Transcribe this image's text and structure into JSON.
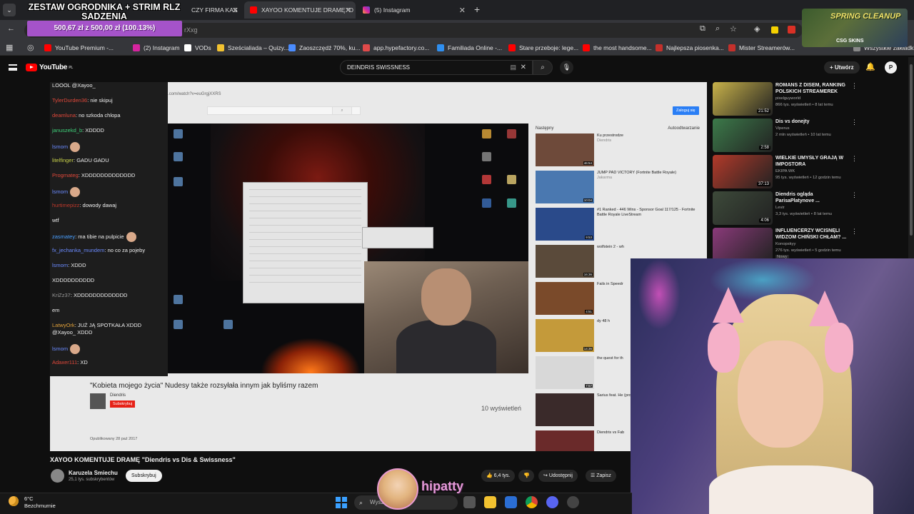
{
  "overlay": {
    "goal_title": "ZESTAW OGRODNIKA + STRIM RLZ SADZENIA",
    "goal_progress": "500,67 zł z 500,00 zł (100.13%)",
    "goal_percent": 100.13,
    "streamer_name": "hipatty",
    "promo_title": "SPRING CLEANUP",
    "promo_brand": "CSG SKINS"
  },
  "tabs": [
    {
      "label": "CZY FIRMA KAS",
      "active": false
    },
    {
      "label": "XAYOO KOMENTUJE DRAMĘ \"D",
      "active": true
    },
    {
      "label": "(5) Instagram",
      "active": false
    }
  ],
  "omnibox": {
    "url_fragment": "rXxg"
  },
  "bookmarks": [
    {
      "label": "YouTube Premium -...",
      "color": "#ff0000"
    },
    {
      "label": "(2) Instagram",
      "color": "#d6249f"
    },
    {
      "label": "VODs",
      "color": "#ffffff"
    },
    {
      "label": "Sześcialiada – Quizy...",
      "color": "#f2c230"
    },
    {
      "label": "Zaoszczędź 70%, ku...",
      "color": "#4a8cff"
    },
    {
      "label": "app.hypefactory.co...",
      "color": "#e04a4a"
    },
    {
      "label": "Familiada Online -...",
      "color": "#2f8ff0"
    },
    {
      "label": "Stare przeboje: lege...",
      "color": "#ff0000"
    },
    {
      "label": "the most handsome...",
      "color": "#ff0000"
    },
    {
      "label": "Najlepsza piosenka...",
      "color": "#c4302b"
    },
    {
      "label": "Mister Streamerów...",
      "color": "#c4302b"
    },
    {
      "label": "Wszystkie zakładki",
      "color": "#888888"
    }
  ],
  "youtube": {
    "logo": "YouTube",
    "region": "PL",
    "search_value": "DEINDRIS SWISSNESS",
    "create_label": "Utwórz",
    "account_initial": "P"
  },
  "chat": [
    {
      "user": "",
      "text": "LOOOL @Xayoo_",
      "color": "#efefef",
      "emote": false
    },
    {
      "user": "TylerDurden36",
      "text": "nie skipuj",
      "color": "#e0483a",
      "emote": false
    },
    {
      "user": "deamluna",
      "text": "no szkoda chlopa",
      "color": "#e0483a",
      "emote": false
    },
    {
      "user": "januszekd_b",
      "text": "XDDDD",
      "color": "#3fd27a",
      "emote": false
    },
    {
      "user": "lsmom",
      "text": "",
      "color": "#6b8bff",
      "emote": true
    },
    {
      "user": "litelfinger",
      "text": "GADU GADU",
      "color": "#c8d14a",
      "emote": false
    },
    {
      "user": "Progmateg",
      "text": "XDDDDDDDDDDDDD",
      "color": "#e0483a",
      "emote": false
    },
    {
      "user": "lsmom",
      "text": "",
      "color": "#6b8bff",
      "emote": true
    },
    {
      "user": "hurtimepizz",
      "text": "dowody dawaj",
      "color": "#c0392b",
      "emote": false
    },
    {
      "user": "",
      "text": "wtf",
      "color": "#efefef",
      "emote": false
    },
    {
      "user": "zasmatey",
      "text": "ma tibie na pulpicie",
      "color": "#4aa0ff",
      "emote": true
    },
    {
      "user": "fx_jechanka_mundem",
      "text": "no co za pojeby",
      "color": "#6b8bff",
      "emote": false
    },
    {
      "user": "lsmom",
      "text": "XDDD",
      "color": "#6b8bff",
      "emote": false
    },
    {
      "user": "",
      "text": "XDDDDDDDDDD",
      "color": "#efefef",
      "emote": false
    },
    {
      "user": "KriZz37",
      "text": "XDDDDDDDDDDDDD",
      "color": "#9a9a9a",
      "emote": false
    },
    {
      "user": "",
      "text": "em",
      "color": "#efefef",
      "emote": false
    },
    {
      "user": "LatwyOrk",
      "text": "JUŻ JĄ SPOTKAŁA XDDD",
      "color": "#e0a13a",
      "emote": false
    },
    {
      "user": "",
      "text": "@Xayoo_ XDDD",
      "color": "#efefef",
      "emote": false
    },
    {
      "user": "lsmom",
      "text": "",
      "color": "#6b8bff",
      "emote": true
    },
    {
      "user": "Adaxer111",
      "text": "XD",
      "color": "#e0483a",
      "emote": false
    }
  ],
  "inner_page": {
    "upnext_label": "Następny",
    "autoplay_label": "Autoodtwarzanie",
    "login_label": "Zaloguj się",
    "video_title": "\"Kobieta mojego życia\" Nudesy także rozsyłała innym jak byliśmy razem",
    "channel": "Diendris",
    "subscribe": "Subskrybuj",
    "views": "10 wyświetleń",
    "published": "Opublikowany 28 paź 2017",
    "upnext": [
      {
        "title": "Ku przestrodze",
        "channel": "Diendris",
        "duration": "46:54"
      },
      {
        "title": "JUMP PAD VICTORY (Fortnite Battle Royale)",
        "channel": "Jakarma",
        "duration": "10:04"
      },
      {
        "title": "#1 Ranked - 446 Wins - Sponsor Goal 117/125 - Fortnite Battle Royale LiveStream",
        "channel": "",
        "duration": "9:53"
      },
      {
        "title": "wolfstein 2 - wh",
        "channel": "",
        "duration": "16:36"
      },
      {
        "title": "Fails in Speedr",
        "channel": "",
        "duration": "4:51"
      },
      {
        "title": "dy 48 h",
        "channel": "",
        "duration": "14:36"
      },
      {
        "title": "the quest for th",
        "channel": "",
        "duration": "7:57"
      },
      {
        "title": "Sarius feat. He (prod. Gibbs x",
        "channel": "",
        "duration": ""
      },
      {
        "title": "Diendris vs Fab",
        "channel": "",
        "duration": ""
      }
    ]
  },
  "watch": {
    "title": "XAYOO KOMENTUJE DRAMĘ \"Diendris vs Dis & Swissness\"",
    "channel": "Karuzela Smiechu",
    "subs": "25,1 tys. subskrybentów",
    "subscribe_label": "Subskrybuj",
    "likes": "6,4 tys.",
    "share_label": "Udostępnij",
    "save_label": "Zapisz"
  },
  "sidebar": [
    {
      "title": "ROMANS Z DISEM, RANKING POLSKICH STREAMEREK",
      "channel": "pixelguyworld",
      "meta": "866 tys. wyświetleń • 8 lat temu",
      "duration": "21:52",
      "thumb": "#c8b24a"
    },
    {
      "title": "Dis vs donejty",
      "channel": "Viperus",
      "meta": "2 mln wyświetleń • 10 lat temu",
      "duration": "2:58",
      "thumb": "#3c7a4a"
    },
    {
      "title": "WIELKIE UMYSŁY GRAJĄ W IMPOSTORA",
      "channel": "EKIPA WK",
      "meta": "95 tys. wyświetleń • 12 godzin temu",
      "duration": "37:13",
      "thumb": "#b23a2a"
    },
    {
      "title": "Diendris ogląda ParisaPlatynove ...",
      "channel": "Levir",
      "meta": "3,3 tys. wyświetleń • 8 lat temu",
      "duration": "4:06",
      "thumb": "#3d4a3a"
    },
    {
      "title": "INFLUENCERZY WCISNĘLI WIDZOM CHIŃSKI CHŁAM? ...",
      "channel": "Konopskyy",
      "meta": "276 tys. wyświetleń • 5 godzin temu",
      "duration": "",
      "thumb": "#8a3a7a"
    }
  ],
  "sidebar_badge": "Nowy",
  "taskbar": {
    "temp": "6°C",
    "weather": "Bezchmurnie",
    "search_placeholder": "Wysz"
  }
}
